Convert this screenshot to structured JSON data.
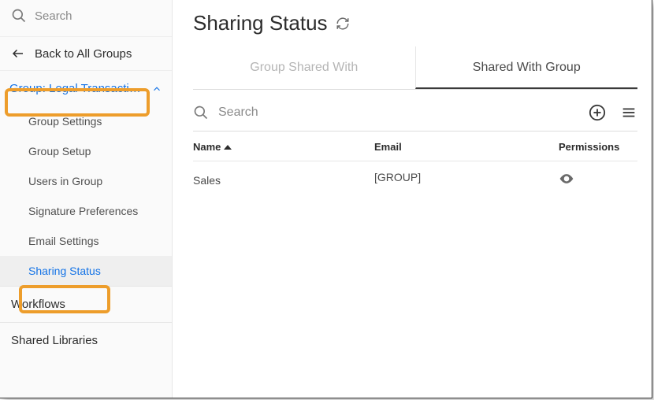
{
  "sidebar": {
    "search_placeholder": "Search",
    "back_label": "Back to All Groups",
    "group_header": "Group: Legal Transacti…",
    "subitems": [
      {
        "label": "Group Settings"
      },
      {
        "label": "Group Setup"
      },
      {
        "label": "Users in Group"
      },
      {
        "label": "Signature Preferences"
      },
      {
        "label": "Email Settings"
      },
      {
        "label": "Sharing Status"
      }
    ],
    "sections": [
      {
        "label": "Workflows"
      },
      {
        "label": "Shared Libraries"
      }
    ]
  },
  "main": {
    "title": "Sharing Status",
    "tabs": [
      {
        "label": "Group Shared With"
      },
      {
        "label": "Shared With Group"
      }
    ],
    "toolbar_search_placeholder": "Search",
    "columns": {
      "name": "Name",
      "email": "Email",
      "permissions": "Permissions"
    },
    "rows": [
      {
        "name": "Sales",
        "email": "[GROUP]",
        "perm_icon": "eye"
      }
    ]
  }
}
